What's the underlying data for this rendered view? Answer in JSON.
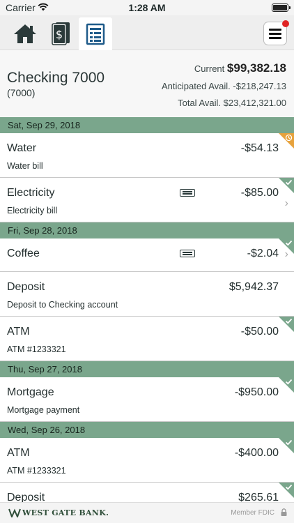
{
  "status_bar": {
    "carrier": "Carrier",
    "time": "1:28 AM"
  },
  "tabs": [
    {
      "name": "home",
      "icon": "home-icon"
    },
    {
      "name": "bills",
      "icon": "dollar-cards-icon"
    },
    {
      "name": "register",
      "icon": "register-icon",
      "active": true
    }
  ],
  "account": {
    "name": "Checking 7000",
    "number": "(7000)",
    "current_label": "Current",
    "current_value": "$99,382.18",
    "anticipated": "Anticipated Avail. -$218,247.13",
    "total": "Total Avail. $23,412,321.00"
  },
  "groups": [
    {
      "date": "Sat, Sep 29, 2018",
      "transactions": [
        {
          "name": "Water",
          "desc": "Water bill",
          "amount": "-$54.13",
          "status": "pending"
        },
        {
          "name": "Electricity",
          "desc": "Electricity bill",
          "amount": "-$85.00",
          "status": "cleared",
          "memo": true,
          "chevron": true
        }
      ]
    },
    {
      "date": "Fri, Sep 28, 2018",
      "transactions": [
        {
          "name": "Coffee",
          "desc": "",
          "amount": "-$2.04",
          "status": "cleared",
          "memo": true,
          "chevron": true,
          "single": true
        },
        {
          "name": "Deposit",
          "desc": "Deposit to Checking account",
          "amount": "$5,942.37",
          "status": "none"
        },
        {
          "name": "ATM",
          "desc": "ATM #1233321",
          "amount": "-$50.00",
          "status": "cleared"
        }
      ]
    },
    {
      "date": "Thu, Sep 27, 2018",
      "transactions": [
        {
          "name": "Mortgage",
          "desc": "Mortgage payment",
          "amount": "-$950.00",
          "status": "cleared"
        }
      ]
    },
    {
      "date": "Wed, Sep 26, 2018",
      "transactions": [
        {
          "name": "ATM",
          "desc": "ATM #1233321",
          "amount": "-$400.00",
          "status": "cleared"
        },
        {
          "name": "Deposit",
          "desc": "",
          "amount": "$265.61",
          "status": "cleared"
        }
      ]
    }
  ],
  "footer": {
    "brand": "WEST GATE BANK.",
    "fdic": "Member FDIC"
  },
  "colors": {
    "header_green": "#7aa68c",
    "pending_orange": "#e7a23c",
    "notification_red": "#e02424"
  }
}
